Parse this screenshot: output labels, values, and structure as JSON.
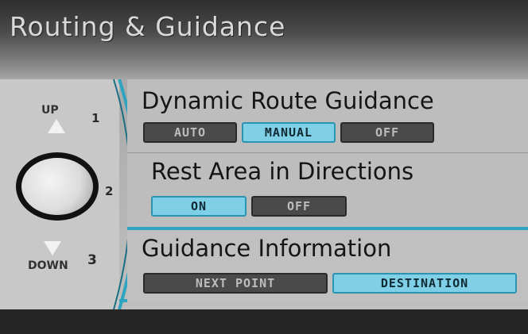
{
  "screen": {
    "title": "Routing & Guidance",
    "accent_color": "#2fa4c0",
    "selected_color": "#7fd0e6",
    "unselected_color": "#4a4a4a"
  },
  "knob": {
    "up_label": "UP",
    "down_label": "DOWN",
    "positions": [
      "1",
      "2",
      "3"
    ],
    "up_icon": "triangle-up-icon",
    "down_icon": "triangle-down-icon"
  },
  "sections": [
    {
      "title": "Dynamic Route Guidance",
      "options": [
        "AUTO",
        "MANUAL",
        "OFF"
      ],
      "selected": "MANUAL"
    },
    {
      "title": "Rest Area in Directions",
      "options": [
        "ON",
        "OFF"
      ],
      "selected": "ON"
    },
    {
      "title": "Guidance Information",
      "options": [
        "NEXT POINT",
        "DESTINATION"
      ],
      "selected": "DESTINATION"
    }
  ]
}
